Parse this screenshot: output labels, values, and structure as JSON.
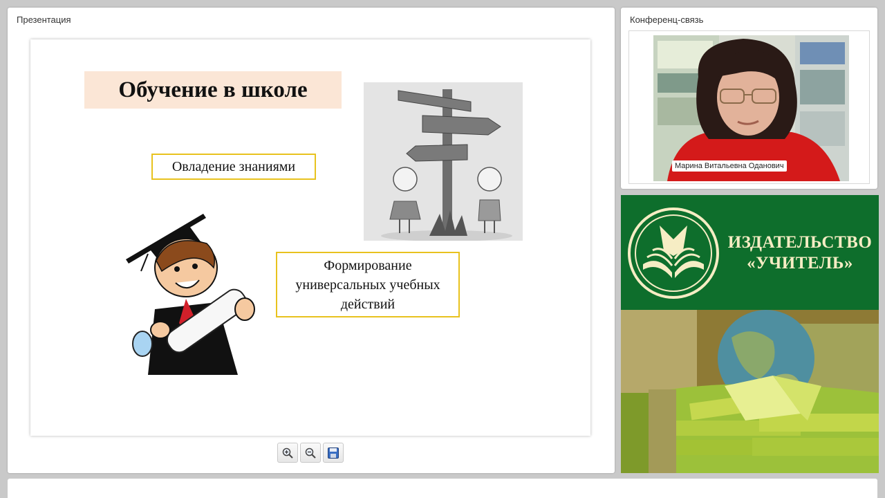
{
  "presentation": {
    "panel_title": "Презентация",
    "slide": {
      "title": "Обучение в школе",
      "box1": "Овладение знаниями",
      "box2": "Формирование\nуниверсальных учебных\nдействий"
    },
    "toolbar": {
      "zoom_in": "zoom-in-icon",
      "zoom_out": "zoom-out-icon",
      "save": "save-icon"
    }
  },
  "conference": {
    "panel_title": "Конференц-связь",
    "participant_name": "Марина Витальевна Оданович"
  },
  "publisher": {
    "name": "ИЗДАТЕЛЬСТВО\n«УЧИТЕЛЬ»"
  },
  "colors": {
    "box_border": "#e8c21e",
    "title_bg": "#fbe6d6",
    "publisher_green": "#0e6e2c",
    "publisher_text": "#f6edc4"
  }
}
